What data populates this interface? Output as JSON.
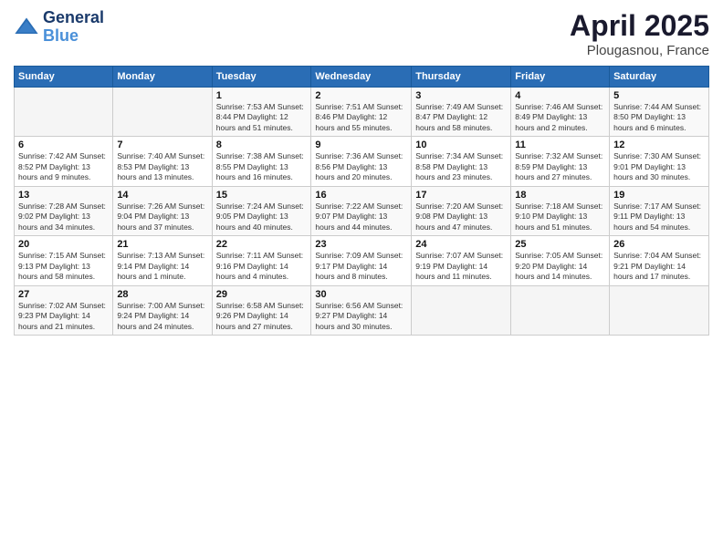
{
  "header": {
    "logo_line1": "General",
    "logo_line2": "Blue",
    "title": "April 2025",
    "subtitle": "Plougasnou, France"
  },
  "weekdays": [
    "Sunday",
    "Monday",
    "Tuesday",
    "Wednesday",
    "Thursday",
    "Friday",
    "Saturday"
  ],
  "weeks": [
    [
      {
        "day": "",
        "info": ""
      },
      {
        "day": "",
        "info": ""
      },
      {
        "day": "1",
        "info": "Sunrise: 7:53 AM\nSunset: 8:44 PM\nDaylight: 12 hours and 51 minutes."
      },
      {
        "day": "2",
        "info": "Sunrise: 7:51 AM\nSunset: 8:46 PM\nDaylight: 12 hours and 55 minutes."
      },
      {
        "day": "3",
        "info": "Sunrise: 7:49 AM\nSunset: 8:47 PM\nDaylight: 12 hours and 58 minutes."
      },
      {
        "day": "4",
        "info": "Sunrise: 7:46 AM\nSunset: 8:49 PM\nDaylight: 13 hours and 2 minutes."
      },
      {
        "day": "5",
        "info": "Sunrise: 7:44 AM\nSunset: 8:50 PM\nDaylight: 13 hours and 6 minutes."
      }
    ],
    [
      {
        "day": "6",
        "info": "Sunrise: 7:42 AM\nSunset: 8:52 PM\nDaylight: 13 hours and 9 minutes."
      },
      {
        "day": "7",
        "info": "Sunrise: 7:40 AM\nSunset: 8:53 PM\nDaylight: 13 hours and 13 minutes."
      },
      {
        "day": "8",
        "info": "Sunrise: 7:38 AM\nSunset: 8:55 PM\nDaylight: 13 hours and 16 minutes."
      },
      {
        "day": "9",
        "info": "Sunrise: 7:36 AM\nSunset: 8:56 PM\nDaylight: 13 hours and 20 minutes."
      },
      {
        "day": "10",
        "info": "Sunrise: 7:34 AM\nSunset: 8:58 PM\nDaylight: 13 hours and 23 minutes."
      },
      {
        "day": "11",
        "info": "Sunrise: 7:32 AM\nSunset: 8:59 PM\nDaylight: 13 hours and 27 minutes."
      },
      {
        "day": "12",
        "info": "Sunrise: 7:30 AM\nSunset: 9:01 PM\nDaylight: 13 hours and 30 minutes."
      }
    ],
    [
      {
        "day": "13",
        "info": "Sunrise: 7:28 AM\nSunset: 9:02 PM\nDaylight: 13 hours and 34 minutes."
      },
      {
        "day": "14",
        "info": "Sunrise: 7:26 AM\nSunset: 9:04 PM\nDaylight: 13 hours and 37 minutes."
      },
      {
        "day": "15",
        "info": "Sunrise: 7:24 AM\nSunset: 9:05 PM\nDaylight: 13 hours and 40 minutes."
      },
      {
        "day": "16",
        "info": "Sunrise: 7:22 AM\nSunset: 9:07 PM\nDaylight: 13 hours and 44 minutes."
      },
      {
        "day": "17",
        "info": "Sunrise: 7:20 AM\nSunset: 9:08 PM\nDaylight: 13 hours and 47 minutes."
      },
      {
        "day": "18",
        "info": "Sunrise: 7:18 AM\nSunset: 9:10 PM\nDaylight: 13 hours and 51 minutes."
      },
      {
        "day": "19",
        "info": "Sunrise: 7:17 AM\nSunset: 9:11 PM\nDaylight: 13 hours and 54 minutes."
      }
    ],
    [
      {
        "day": "20",
        "info": "Sunrise: 7:15 AM\nSunset: 9:13 PM\nDaylight: 13 hours and 58 minutes."
      },
      {
        "day": "21",
        "info": "Sunrise: 7:13 AM\nSunset: 9:14 PM\nDaylight: 14 hours and 1 minute."
      },
      {
        "day": "22",
        "info": "Sunrise: 7:11 AM\nSunset: 9:16 PM\nDaylight: 14 hours and 4 minutes."
      },
      {
        "day": "23",
        "info": "Sunrise: 7:09 AM\nSunset: 9:17 PM\nDaylight: 14 hours and 8 minutes."
      },
      {
        "day": "24",
        "info": "Sunrise: 7:07 AM\nSunset: 9:19 PM\nDaylight: 14 hours and 11 minutes."
      },
      {
        "day": "25",
        "info": "Sunrise: 7:05 AM\nSunset: 9:20 PM\nDaylight: 14 hours and 14 minutes."
      },
      {
        "day": "26",
        "info": "Sunrise: 7:04 AM\nSunset: 9:21 PM\nDaylight: 14 hours and 17 minutes."
      }
    ],
    [
      {
        "day": "27",
        "info": "Sunrise: 7:02 AM\nSunset: 9:23 PM\nDaylight: 14 hours and 21 minutes."
      },
      {
        "day": "28",
        "info": "Sunrise: 7:00 AM\nSunset: 9:24 PM\nDaylight: 14 hours and 24 minutes."
      },
      {
        "day": "29",
        "info": "Sunrise: 6:58 AM\nSunset: 9:26 PM\nDaylight: 14 hours and 27 minutes."
      },
      {
        "day": "30",
        "info": "Sunrise: 6:56 AM\nSunset: 9:27 PM\nDaylight: 14 hours and 30 minutes."
      },
      {
        "day": "",
        "info": ""
      },
      {
        "day": "",
        "info": ""
      },
      {
        "day": "",
        "info": ""
      }
    ]
  ]
}
